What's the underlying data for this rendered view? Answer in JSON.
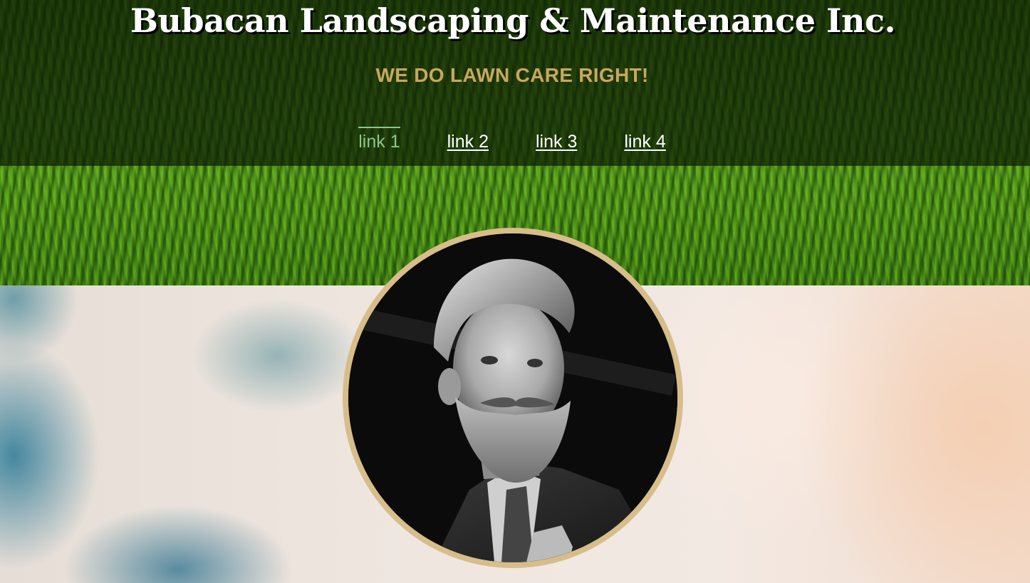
{
  "header": {
    "title": "Bubacan Landscaping & Maintenance Inc.",
    "tagline": "WE DO LAWN CARE RIGHT!"
  },
  "nav": {
    "links": [
      {
        "label": "link 1",
        "active": true
      },
      {
        "label": "link 2",
        "active": false
      },
      {
        "label": "link 3",
        "active": false
      },
      {
        "label": "link 4",
        "active": false
      }
    ]
  },
  "colors": {
    "tagline": "#c9a75e",
    "active_link": "#8fc48a",
    "portrait_ring": "#d7bd8a",
    "header_overlay": "#0c1c04"
  }
}
